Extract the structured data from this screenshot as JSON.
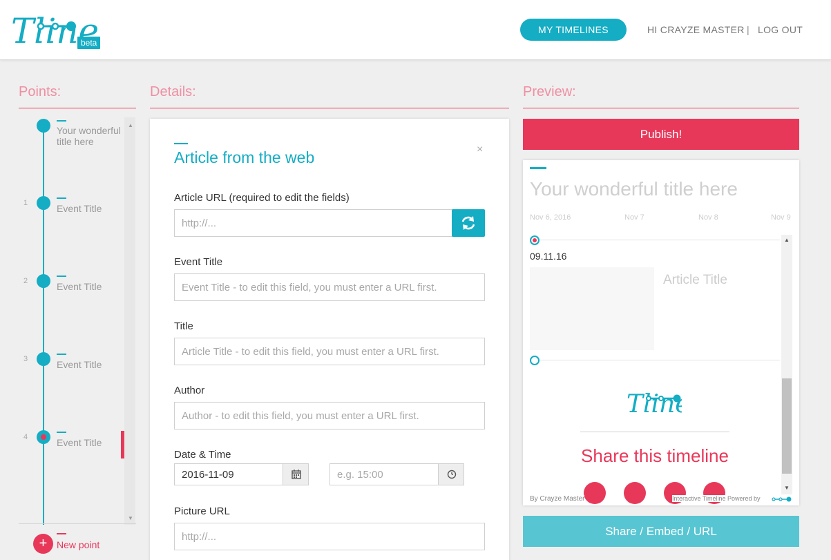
{
  "header": {
    "logo_text": "Tline",
    "beta_label": "beta",
    "my_timelines_label": "MY TIMELINES",
    "greeting": "HI CRAYZE MASTER",
    "separator": "|",
    "logout_label": "LOG OUT"
  },
  "sections": {
    "points_title": "Points:",
    "details_title": "Details:",
    "preview_title": "Preview:"
  },
  "points": {
    "title_point_label": "Your wonderful title here",
    "items": [
      {
        "number": "1",
        "label": "Event Title"
      },
      {
        "number": "2",
        "label": "Event Title"
      },
      {
        "number": "3",
        "label": "Event Title"
      },
      {
        "number": "4",
        "label": "Event Title"
      }
    ],
    "new_point_label": "New point",
    "new_point_icon": "+"
  },
  "details": {
    "card_title": "Article from the web",
    "close_icon": "×",
    "article_url_label": "Article URL (required to edit the fields)",
    "article_url_placeholder": "http://...",
    "event_title_label": "Event Title",
    "event_title_placeholder": "Event Title - to edit this field, you must enter a URL first.",
    "title_label": "Title",
    "title_placeholder": "Article Title - to edit this field, you must enter a URL first.",
    "author_label": "Author",
    "author_placeholder": "Author - to edit this field, you must enter a URL first.",
    "datetime_label": "Date & Time",
    "date_value": "2016-11-09",
    "time_placeholder": "e.g. 15:00",
    "picture_url_label": "Picture URL",
    "picture_url_placeholder": "http://..."
  },
  "preview": {
    "publish_label": "Publish!",
    "title": "Your wonderful title here",
    "dates": [
      "Nov 6, 2016",
      "Nov 7",
      "Nov 8",
      "Nov 9"
    ],
    "event_date": "09.11.16",
    "article_title": "Article Title",
    "share_title": "Share this timeline",
    "footer_left": "By Crayze Master",
    "footer_right": "Interactive Timeline Powered by",
    "share_button_label": "Share / Embed / URL"
  },
  "colors": {
    "accent": "#14adc4",
    "brand_red": "#e8385a",
    "share_button": "#58c5d2"
  }
}
